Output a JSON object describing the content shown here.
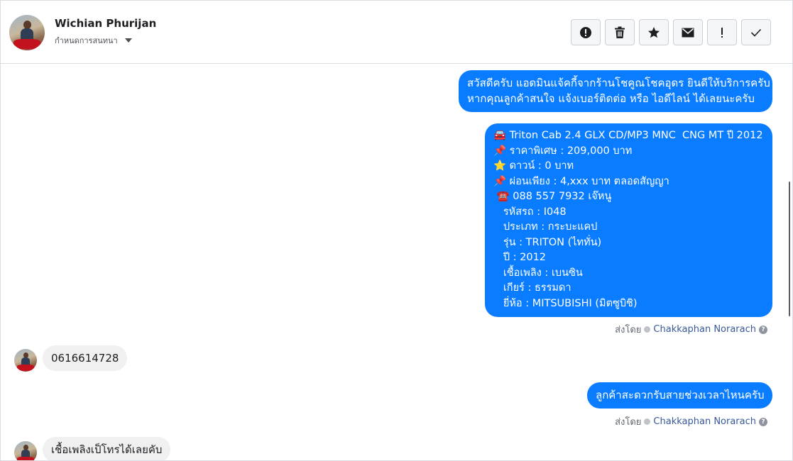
{
  "header": {
    "contact_name": "Wichian Phurijan",
    "assign_label": "กำหนดการสนทนา",
    "toolbar": [
      {
        "name": "report-button",
        "icon": "alert-circle-icon",
        "label": "Mark as spam"
      },
      {
        "name": "delete-button",
        "icon": "trash-icon",
        "label": "Delete"
      },
      {
        "name": "star-button",
        "icon": "star-icon",
        "label": "Star"
      },
      {
        "name": "unread-button",
        "icon": "envelope-icon",
        "label": "Mark as unread"
      },
      {
        "name": "follow-up-button",
        "icon": "exclamation-icon",
        "label": "Follow up"
      },
      {
        "name": "done-button",
        "icon": "check-icon",
        "label": "Done"
      }
    ]
  },
  "messages": {
    "greeting": {
      "line1": "สวัสดีครับ แอดมินแจ้คกี้จากร้านโชคูณโชคอุดร ยินดีให้บริการครับ",
      "line2": "หากคุณลูกค้าสนใจ แจ้งเบอร์ติดต่อ หรือ ไอดีไลน์ ได้เลยนะครับ"
    },
    "listing": {
      "title": "🚘 Triton Cab 2.4 GLX CD/MP3 MNC  CNG MT ปี 2012",
      "price": "📌 ราคาพิเศษ : 209,000 บาท",
      "down": "⭐ ดาวน์ : 0 บาท",
      "installment": "📌 ผ่อนเพียง : 4,xxx บาท ตลอดสัญญา",
      "phone": " ☎️ 088 557 7932 เจ๊หนู",
      "code": "   รหัสรถ : I048",
      "type": "   ประเภท : กระบะแคป",
      "model": "   รุ่น : TRITON (ไททั่น)",
      "year": "   ปี : 2012",
      "fuel": "   เชื้อเพลิง : เบนซิน",
      "gear": "   เกียร์ : ธรรมดา",
      "brand": "   ยี่ห้อ : MITSUBISHI (มิตซูบิชิ)"
    },
    "sent_by_1": {
      "prefix": "ส่งโดย",
      "name": "Chakkaphan Norarach",
      "help": "?"
    },
    "customer_phone": "0616614728",
    "ask_time": "ลูกค้าสะดวกรับสายช่วงเวลาไหนครับ",
    "sent_by_2": {
      "prefix": "ส่งโดย",
      "name": "Chakkaphan Norarach",
      "help": "?"
    },
    "customer_reply": "เชื้อเพลิงเป็โทรได้เลยคับ"
  },
  "colors": {
    "outgoing_bubble": "#0a7cff",
    "incoming_bubble": "#f0f0f0",
    "link": "#385898"
  }
}
